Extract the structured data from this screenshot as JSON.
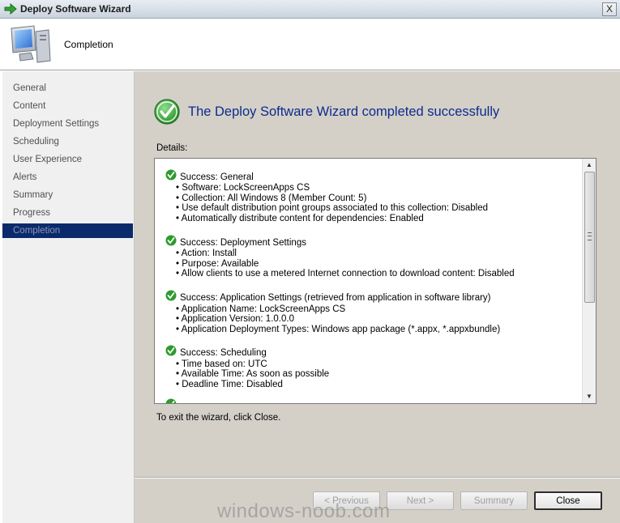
{
  "window": {
    "title": "Deploy Software Wizard",
    "close_glyph": "X"
  },
  "header": {
    "title": "Completion",
    "icon": "computer-icon"
  },
  "nav": {
    "items": [
      {
        "label": "General"
      },
      {
        "label": "Content"
      },
      {
        "label": "Deployment Settings"
      },
      {
        "label": "Scheduling"
      },
      {
        "label": "User Experience"
      },
      {
        "label": "Alerts"
      },
      {
        "label": "Summary"
      },
      {
        "label": "Progress"
      },
      {
        "label": "Completion",
        "selected": true
      }
    ]
  },
  "main": {
    "heading": "The Deploy Software Wizard completed successfully",
    "details_label": "Details:",
    "exit_text": "To exit the wizard, click Close.",
    "sections": [
      {
        "title": "Success: General",
        "bullets": [
          "Software: LockScreenApps CS",
          "Collection: All Windows 8 (Member Count: 5)",
          "Use default distribution point groups associated to this collection: Disabled",
          "Automatically distribute content for dependencies: Enabled"
        ]
      },
      {
        "title": "Success: Deployment Settings",
        "bullets": [
          "Action: Install",
          "Purpose: Available",
          "Allow clients to use a metered Internet connection to download content: Disabled"
        ]
      },
      {
        "title": "Success: Application Settings (retrieved from application in software library)",
        "bullets": [
          "Application Name: LockScreenApps CS",
          "Application Version: 1.0.0.0",
          "Application Deployment Types: Windows app package (*.appx, *.appxbundle)"
        ]
      },
      {
        "title": "Success: Scheduling",
        "bullets": [
          "Time based on: UTC",
          "Available Time: As soon as possible",
          "Deadline Time: Disabled"
        ]
      }
    ]
  },
  "buttons": {
    "previous": "< Previous",
    "next": "Next >",
    "summary": "Summary",
    "close": "Close"
  },
  "watermark": "windows-noob.com",
  "colors": {
    "accent": "#0b2a6b",
    "heading": "#0d2b8c",
    "success": "#2e9a2e"
  }
}
